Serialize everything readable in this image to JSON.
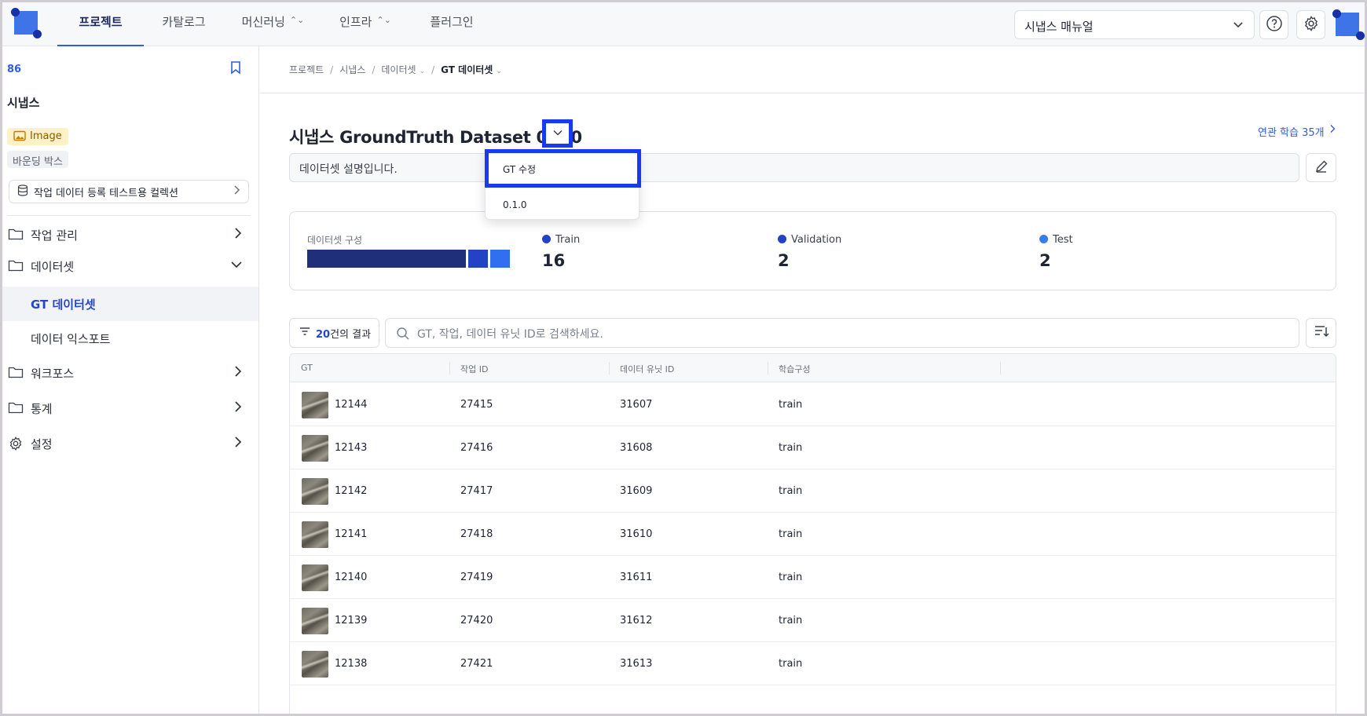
{
  "topbar": {
    "nav": [
      {
        "label": "프로젝트",
        "active": true,
        "has_chevron": false
      },
      {
        "label": "카탈로그",
        "active": false,
        "has_chevron": false
      },
      {
        "label": "머신러닝",
        "active": false,
        "has_chevron": true
      },
      {
        "label": "인프라",
        "active": false,
        "has_chevron": true
      },
      {
        "label": "플러그인",
        "active": false,
        "has_chevron": false
      }
    ],
    "manual_select": "시냅스 매뉴얼",
    "icons": [
      "help-icon",
      "gear-icon"
    ]
  },
  "sidebar": {
    "project_id": "86",
    "project_name": "시냅스",
    "badge_image": "Image",
    "badge_type": "바운딩 박스",
    "collection": "작업 데이터 등록 테스트용 컬렉션",
    "menu": {
      "work": "작업 관리",
      "dataset": "데이터셋",
      "gt_dataset": "GT 데이터셋",
      "data_export": "데이터 익스포트",
      "workforce": "워크포스",
      "stats": "통계",
      "settings": "설정"
    }
  },
  "breadcrumb": [
    "프로젝트",
    "시냅스",
    "데이터셋",
    "GT 데이터셋"
  ],
  "dataset": {
    "title": "시냅스 GroundTruth Dataset 0.1.0",
    "related": "연관 학습 35개",
    "description": "데이터셋 설명입니다.",
    "dropdown": [
      "GT 수정",
      "0.1.0"
    ]
  },
  "composition": {
    "label": "데이터셋 구성",
    "splits": [
      {
        "name": "Train",
        "count": 16,
        "color": "#1f2f7a"
      },
      {
        "name": "Validation",
        "count": 2,
        "color": "#2342c4"
      },
      {
        "name": "Test",
        "count": 2,
        "color": "#2f6ff0"
      }
    ]
  },
  "toolbar": {
    "result_count": "20",
    "result_suffix": "건의 결과",
    "search_placeholder": "GT, 작업, 데이터 유닛 ID로 검색하세요."
  },
  "table": {
    "columns": [
      "GT",
      "작업 ID",
      "데이터 유닛 ID",
      "학습구성"
    ],
    "rows": [
      {
        "gt": "12144",
        "task": "27415",
        "unit": "31607",
        "split": "train"
      },
      {
        "gt": "12143",
        "task": "27416",
        "unit": "31608",
        "split": "train"
      },
      {
        "gt": "12142",
        "task": "27417",
        "unit": "31609",
        "split": "train"
      },
      {
        "gt": "12141",
        "task": "27418",
        "unit": "31610",
        "split": "train"
      },
      {
        "gt": "12140",
        "task": "27419",
        "unit": "31611",
        "split": "train"
      },
      {
        "gt": "12139",
        "task": "27420",
        "unit": "31612",
        "split": "train"
      },
      {
        "gt": "12138",
        "task": "27421",
        "unit": "31613",
        "split": "train"
      }
    ]
  }
}
